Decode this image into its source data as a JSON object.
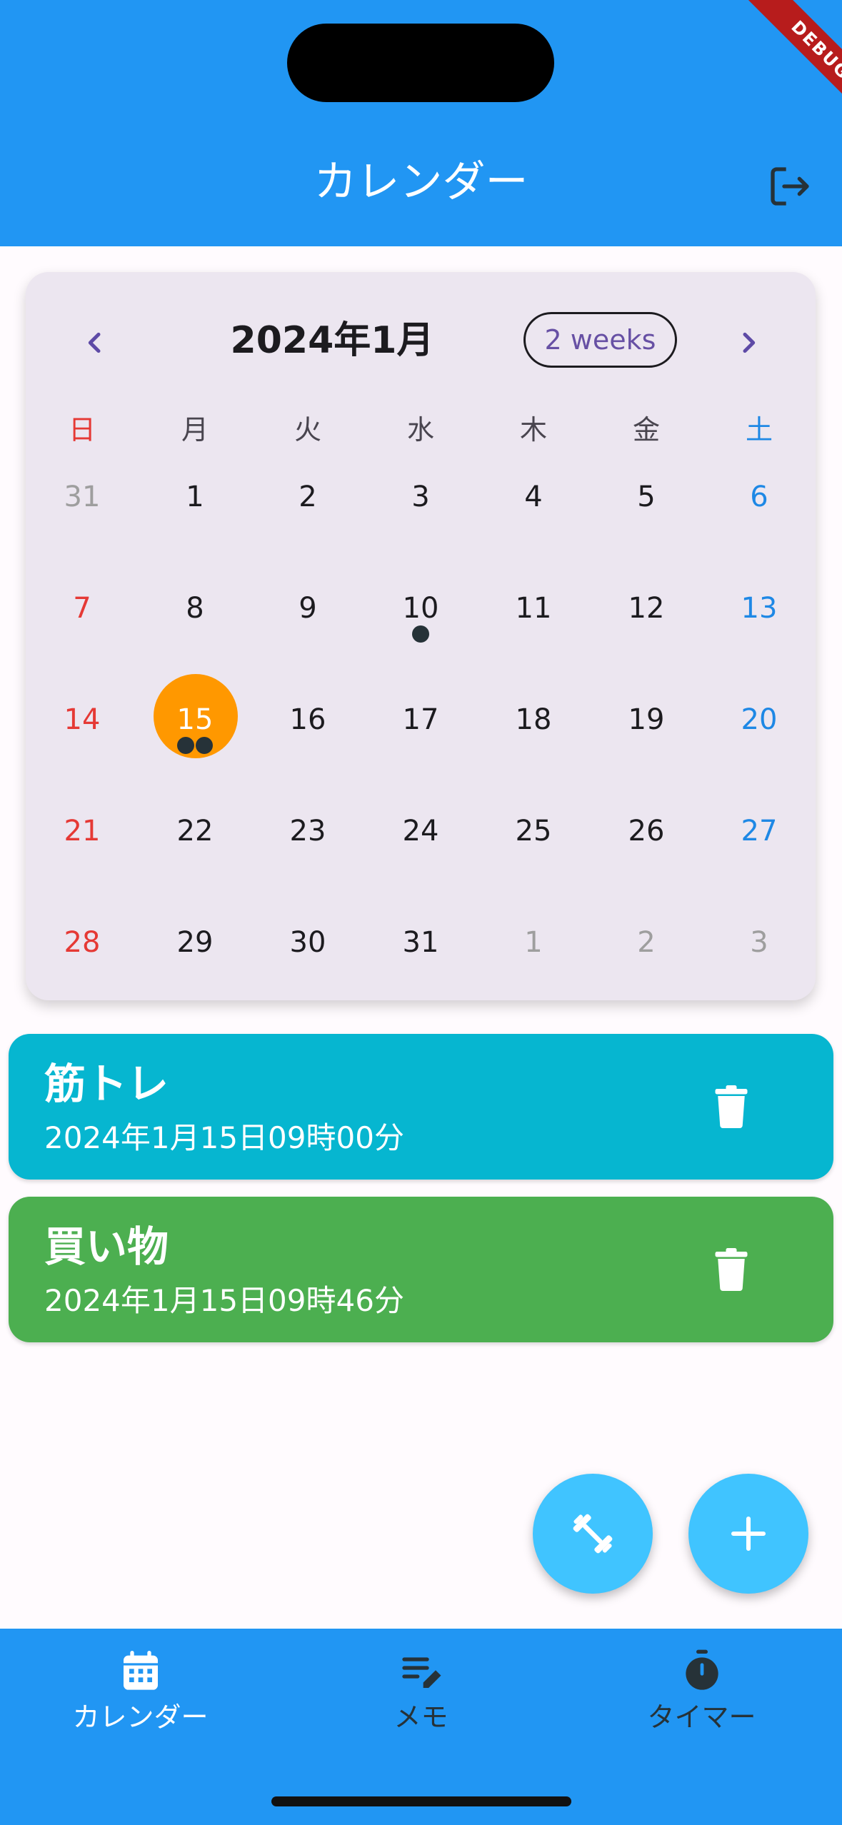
{
  "status": {
    "debug_banner": "DEBUG"
  },
  "header": {
    "title": "カレンダー",
    "logout_icon": "logout-icon"
  },
  "calendar": {
    "month_title": "2024年1月",
    "format_button": "2 weeks",
    "prev_icon": "chevron-left-icon",
    "next_icon": "chevron-right-icon",
    "weekdays": [
      "日",
      "月",
      "火",
      "水",
      "木",
      "金",
      "土"
    ],
    "weeks": [
      [
        {
          "d": "31",
          "out": true
        },
        {
          "d": "1"
        },
        {
          "d": "2"
        },
        {
          "d": "3"
        },
        {
          "d": "4"
        },
        {
          "d": "5"
        },
        {
          "d": "6"
        }
      ],
      [
        {
          "d": "7"
        },
        {
          "d": "8"
        },
        {
          "d": "9"
        },
        {
          "d": "10",
          "events": 1
        },
        {
          "d": "11"
        },
        {
          "d": "12"
        },
        {
          "d": "13"
        }
      ],
      [
        {
          "d": "14"
        },
        {
          "d": "15",
          "selected": true,
          "events": 2
        },
        {
          "d": "16"
        },
        {
          "d": "17"
        },
        {
          "d": "18"
        },
        {
          "d": "19"
        },
        {
          "d": "20"
        }
      ],
      [
        {
          "d": "21"
        },
        {
          "d": "22"
        },
        {
          "d": "23"
        },
        {
          "d": "24"
        },
        {
          "d": "25"
        },
        {
          "d": "26"
        },
        {
          "d": "27"
        }
      ],
      [
        {
          "d": "28"
        },
        {
          "d": "29"
        },
        {
          "d": "30"
        },
        {
          "d": "31"
        },
        {
          "d": "1",
          "out": true
        },
        {
          "d": "2",
          "out": true
        },
        {
          "d": "3",
          "out": true
        }
      ]
    ],
    "colors": {
      "sunday": "#E53935",
      "saturday": "#1E88E5",
      "selected": "#FF9800",
      "marker": "#263238"
    }
  },
  "events": [
    {
      "name": "筋トレ",
      "datetime": "2024年1月15日09時00分",
      "color": "#06B6D0",
      "delete_icon": "trash-icon"
    },
    {
      "name": "買い物",
      "datetime": "2024年1月15日09時46分",
      "color": "#4CAF50",
      "delete_icon": "trash-icon"
    }
  ],
  "fabs": [
    {
      "icon": "dumbbell-icon",
      "color": "#40C4FF"
    },
    {
      "icon": "plus-icon",
      "color": "#40C4FF"
    }
  ],
  "bottom_nav": {
    "items": [
      {
        "label": "カレンダー",
        "icon": "calendar-icon",
        "active": true
      },
      {
        "label": "メモ",
        "icon": "edit-note-icon",
        "active": false
      },
      {
        "label": "タイマー",
        "icon": "timer-icon",
        "active": false
      }
    ],
    "active_color": "#FFFFFF",
    "inactive_color": "#263238"
  }
}
